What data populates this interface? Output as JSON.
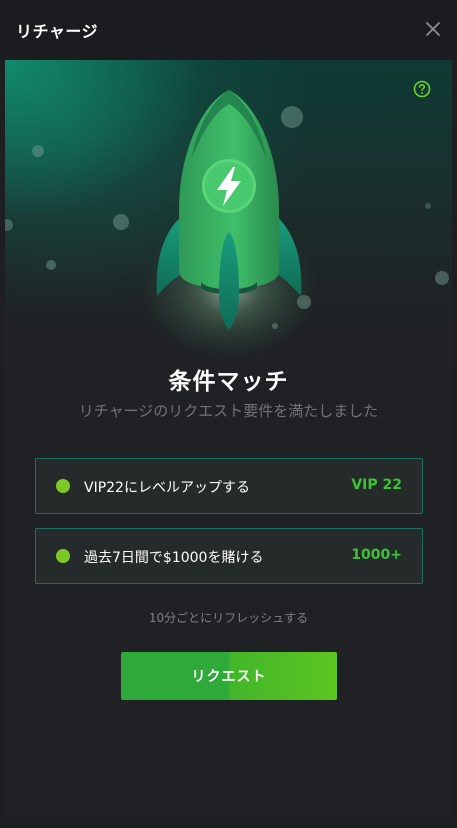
{
  "header": {
    "title": "リチャージ",
    "close_icon": "close-icon"
  },
  "panel": {
    "help_icon": "help-circle-icon",
    "illustration": "rocket-lightning-illustration",
    "title": "条件マッチ",
    "subtitle": "リチャージのリクエスト要件を満たしました",
    "conditions": [
      {
        "label": "VIP22にレベルアップする",
        "value": "VIP 22"
      },
      {
        "label": "過去7日間で$1000を賭ける",
        "value": "1000+"
      }
    ],
    "refresh_note": "10分ごとにリフレッシュする",
    "request_button": "リクエスト"
  },
  "colors": {
    "accent_green": "#3dc335",
    "dot_green": "#7ec825",
    "teal_border": "#1d6e63",
    "background": "#1e1f23"
  }
}
